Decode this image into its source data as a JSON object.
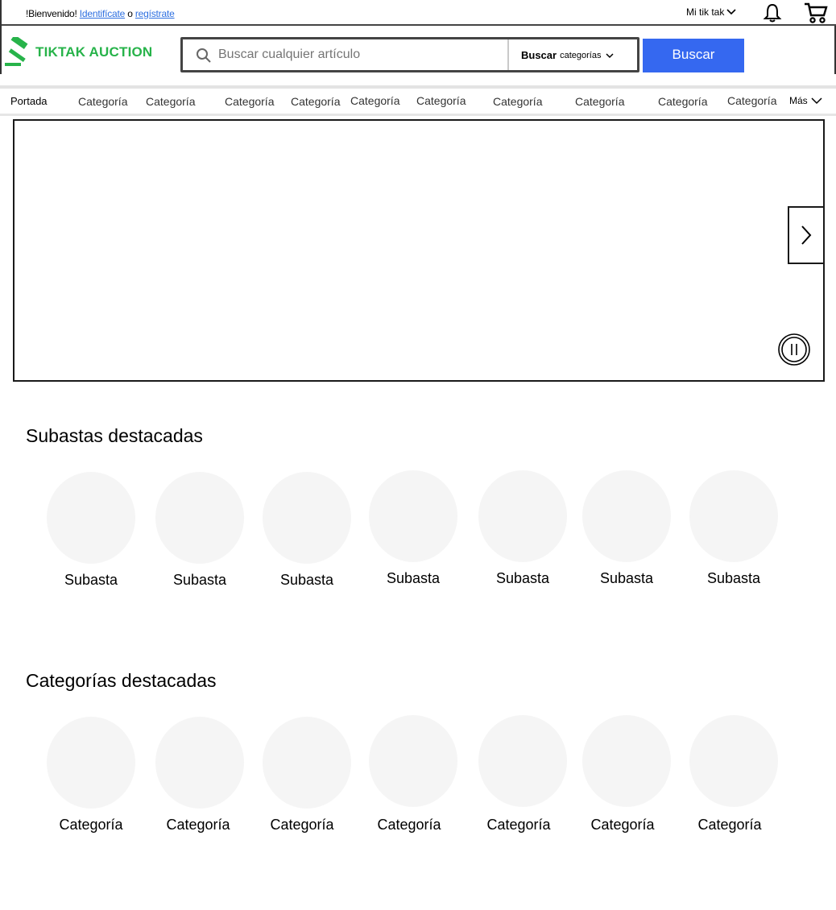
{
  "topbar": {
    "greeting": "!Bienvenido!",
    "signin_link": "Identifícate",
    "or_text": "o",
    "register_link": "regístrate",
    "my_account_label": "Mi tik tak"
  },
  "header": {
    "logo_text": "TIKTAK AUCTION",
    "search_placeholder": "Buscar cualquier artículo",
    "category_select_bold": "Buscar",
    "category_select_rest": "categorías",
    "search_button": "Buscar"
  },
  "nav": {
    "home": "Portada",
    "categories": [
      "Categoría",
      "Categoría",
      "Categoría",
      "Categoría",
      "Categoría",
      "Categoría",
      "Categoría",
      "Categoría",
      "Categoría",
      "Categoría"
    ],
    "more": "Más"
  },
  "featured_auctions": {
    "title": "Subastas destacadas",
    "items": [
      "Subasta",
      "Subasta",
      "Subasta",
      "Subasta",
      "Subasta",
      "Subasta",
      "Subasta"
    ]
  },
  "featured_categories": {
    "title": "Categorías destacadas",
    "items": [
      "Categoría",
      "Categoría",
      "Categoría",
      "Categoría",
      "Categoría",
      "Categoría",
      "Categoría"
    ]
  },
  "colors": {
    "brand_green": "#27b34a",
    "button_blue": "#3568f0",
    "link_blue": "#2d6fe0",
    "placeholder_gray": "#f5f5f5"
  }
}
